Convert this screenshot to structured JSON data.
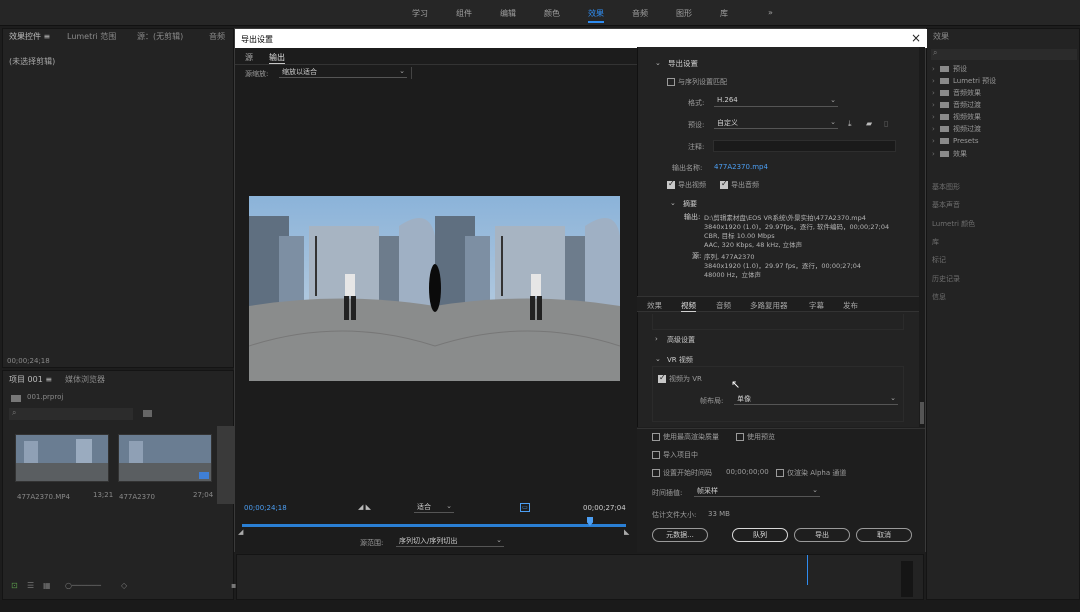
{
  "topbar": {
    "workspaces": [
      "学习",
      "组件",
      "编辑",
      "颜色",
      "效果",
      "音频",
      "图形",
      "库"
    ],
    "more": "»",
    "active_index": 4
  },
  "left_panel": {
    "tabs": [
      "效果控件 ≡",
      "Lumetri 范围",
      "源：(无剪辑)",
      "音频"
    ],
    "no_clip": "(未选择剪辑)",
    "timecode": "00;00;24;18"
  },
  "project_panel": {
    "tabs": [
      "项目 001 ≡",
      "媒体浏览器"
    ],
    "project_file": "001.prproj",
    "clips": [
      {
        "name": "477A2370.MP4",
        "duration": "13;21"
      },
      {
        "name": "477A2370",
        "duration": "27;04"
      }
    ]
  },
  "right_panel": {
    "title": "效果",
    "tree": [
      "预设",
      "Lumetri 预设",
      "音频效果",
      "音频过渡",
      "视频效果",
      "视频过渡",
      "Presets",
      "效果"
    ],
    "sections": [
      "基本图形",
      "基本声音",
      "Lumetri 颜色",
      "库",
      "标记",
      "历史记录",
      "信息"
    ]
  },
  "dialog": {
    "title": "导出设置",
    "close": "×",
    "tabs": {
      "source": "源",
      "output": "输出"
    },
    "scale_label": "源缩放:",
    "scale_value": "缩放以适合",
    "timecode_start": "00;00;24;18",
    "timecode_end": "00;00;27;04",
    "fit_value": "适合",
    "range_label": "源范围:",
    "range_value": "序列切入/序列切出",
    "export_settings": {
      "header": "导出设置",
      "match_sequence": "与序列设置匹配",
      "format_label": "格式:",
      "format_value": "H.264",
      "preset_label": "预设:",
      "preset_value": "自定义",
      "comment_label": "注释:",
      "output_name_label": "输出名称:",
      "output_name_value": "477A2370.mp4",
      "export_video": "导出视频",
      "export_audio": "导出音频",
      "summary_header": "摘要",
      "output_label": "输出:",
      "output_lines": [
        "D:\\剪辑素材盘\\EOS VR系统\\外景实拍\\477A2370.mp4",
        "3840x1920 (1.0)，29.97fps，逐行, 软件编码，00;00;27;04",
        "CBR, 目标 10.00 Mbps",
        "AAC, 320 Kbps, 48 kHz, 立体声"
      ],
      "source_label": "源:",
      "source_lines": [
        "序列, 477A2370",
        "3840x1920 (1.0)，29.97 fps，逐行，00;00;27;04",
        "48000 Hz，立体声"
      ]
    },
    "settings_tabs": [
      "效果",
      "视频",
      "音频",
      "多路复用器",
      "字幕",
      "发布"
    ],
    "settings_active_tab": 1,
    "advanced_settings": "高级设置",
    "vr_video": "VR 视频",
    "video_is_vr": "视频为 VR",
    "frame_layout_label": "帧布局:",
    "frame_layout_value": "单像",
    "options": {
      "max_render_quality": "使用最高渲染质量",
      "use_previews": "使用预览",
      "import_into_project": "导入项目中",
      "set_start_timecode": "设置开始时间码",
      "start_timecode_value": "00;00;00;00",
      "render_alpha_only": "仅渲染 Alpha 通道",
      "time_interp_label": "时间插值:",
      "time_interp_value": "帧采样",
      "est_file_size_label": "估计文件大小:",
      "est_file_size_value": "33 MB"
    },
    "buttons": {
      "metadata": "元数据...",
      "queue": "队列",
      "export": "导出",
      "cancel": "取消"
    }
  }
}
